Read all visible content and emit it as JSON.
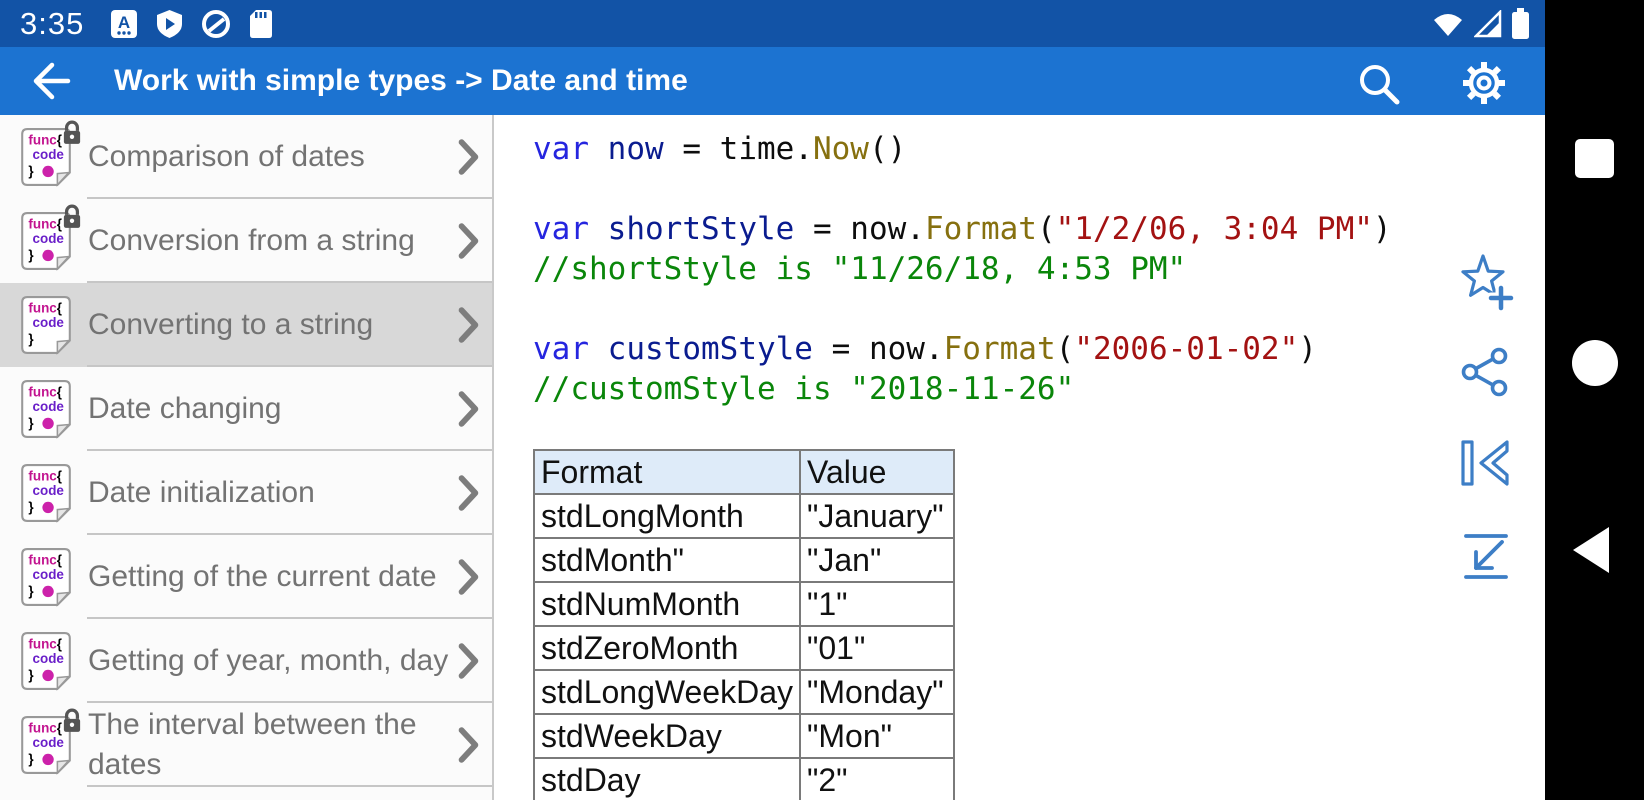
{
  "status_bar": {
    "time": "3:35",
    "icons_left": [
      "a-translate-app-icon",
      "play-protect-icon",
      "quick-circle-icon",
      "sd-card-icon"
    ],
    "icons_right": [
      "wifi-icon",
      "cell-signal-icon",
      "battery-icon"
    ]
  },
  "app_bar": {
    "title": "Work with simple types -> Date and time"
  },
  "sidebar": {
    "items": [
      {
        "label": "Comparison of dates",
        "locked": true,
        "selected": false
      },
      {
        "label": "Conversion from a string",
        "locked": true,
        "selected": false
      },
      {
        "label": "Converting to a string",
        "locked": false,
        "selected": true
      },
      {
        "label": "Date changing",
        "locked": false,
        "selected": false
      },
      {
        "label": "Date initialization",
        "locked": false,
        "selected": false
      },
      {
        "label": "Getting of the current date",
        "locked": false,
        "selected": false
      },
      {
        "label": "Getting of year, month, day",
        "locked": false,
        "selected": false
      },
      {
        "label": "The interval between the dates",
        "locked": true,
        "selected": false
      }
    ]
  },
  "code": {
    "blocks": [
      [
        [
          {
            "c": "kw",
            "t": "var"
          },
          {
            "c": "pl",
            "t": " "
          },
          {
            "c": "id",
            "t": "now"
          },
          {
            "c": "pl",
            "t": " = time."
          },
          {
            "c": "fn",
            "t": "Now"
          },
          {
            "c": "pl",
            "t": "()"
          }
        ]
      ],
      [
        [
          {
            "c": "kw",
            "t": "var"
          },
          {
            "c": "pl",
            "t": " "
          },
          {
            "c": "id",
            "t": "shortStyle"
          },
          {
            "c": "pl",
            "t": " = now."
          },
          {
            "c": "fn",
            "t": "Format"
          },
          {
            "c": "pl",
            "t": "("
          },
          {
            "c": "str",
            "t": "\"1/2/06, 3:04 PM\""
          },
          {
            "c": "pl",
            "t": ")"
          }
        ],
        [
          {
            "c": "cmt",
            "t": "//shortStyle is \"11/26/18, 4:53 PM\""
          }
        ]
      ],
      [
        [
          {
            "c": "kw",
            "t": "var"
          },
          {
            "c": "pl",
            "t": " "
          },
          {
            "c": "id",
            "t": "customStyle"
          },
          {
            "c": "pl",
            "t": " = now."
          },
          {
            "c": "fn",
            "t": "Format"
          },
          {
            "c": "pl",
            "t": "("
          },
          {
            "c": "str",
            "t": "\"2006-01-02\""
          },
          {
            "c": "pl",
            "t": ")"
          }
        ],
        [
          {
            "c": "cmt",
            "t": "//customStyle is \"2018-11-26\""
          }
        ]
      ]
    ]
  },
  "format_table": {
    "headers": [
      "Format",
      "Value"
    ],
    "rows": [
      [
        "stdLongMonth",
        "\"January\""
      ],
      [
        "stdMonth\"",
        "\"Jan\""
      ],
      [
        "stdNumMonth",
        "\"1\""
      ],
      [
        "stdZeroMonth",
        "\"01\""
      ],
      [
        "stdLongWeekDay",
        "\"Monday\""
      ],
      [
        "stdWeekDay",
        "\"Mon\""
      ],
      [
        "stdDay",
        "\"2\""
      ]
    ]
  },
  "action_rail": {
    "buttons": [
      "add-favorite-star-icon",
      "share-icon",
      "skip-to-start-icon",
      "jump-to-end-icon"
    ]
  },
  "nav_bar": {
    "buttons": [
      "recents-square-icon",
      "home-circle-icon",
      "back-triangle-icon"
    ]
  },
  "colors": {
    "status_bar": "#1253A6",
    "app_bar": "#1C73D1",
    "selected_item_bg": "#D8D8D8",
    "rail_icon_blue": "#3D7EC6",
    "table_header_bg": "#DEEBF9",
    "code_keyword": "#2525DF",
    "code_identifier": "#0A1C8F",
    "code_function": "#86700F",
    "code_string": "#A31212",
    "code_comment": "#0A860A"
  }
}
